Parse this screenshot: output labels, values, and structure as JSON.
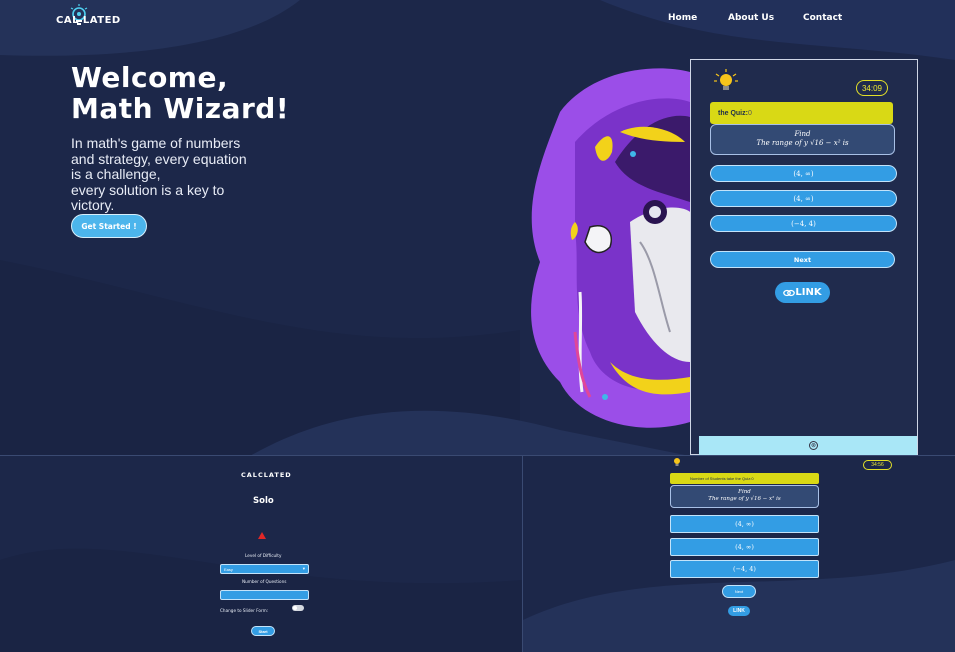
{
  "header": {
    "logo_text": "CAL  LATED",
    "nav": [
      "Home",
      "About Us",
      "Contact"
    ]
  },
  "hero": {
    "title_line1": "Welcome,",
    "title_line2": "Math Wizard!",
    "text_lines": [
      "In math's game of numbers",
      "and strategy, every equation",
      "is a challenge,",
      "every solution is a key to victory."
    ],
    "cta_label": "Get Started !"
  },
  "quiz_panel": {
    "timer": "34:09",
    "banner_label": "the Quiz:",
    "banner_score": "0",
    "question_line1": "Find",
    "question_line2": "The range of y √16 − x² is",
    "options": [
      "(4, ∞)",
      "(4, ∞)",
      "(−4, 4)"
    ],
    "next_label": "Next",
    "link_label": "LINK",
    "close_icon": "⊗"
  },
  "solo_panel": {
    "logo_text": "CALCLATED",
    "title": "Solo",
    "difficulty_label": "Level of Difficulty",
    "difficulty_value": "Easy",
    "questions_label": "Number of Questions",
    "slider_label": "Change to Slider Form:",
    "start_label": "Start"
  },
  "quiz_panel_small": {
    "timer": "34:56",
    "banner_text": "Number of Students take the Quiz:0",
    "question_line1": "Find",
    "question_line2": "The range of y √16 − x² is",
    "options": [
      "(4, ∞)",
      "(4, ∞)",
      "(−4, 4)"
    ],
    "next_label": "Next",
    "link_label": "LINK"
  },
  "colors": {
    "background": "#1c2749",
    "accent_blue": "#339de4",
    "accent_yellow": "#d9d915",
    "wizard_purple": "#9b4ee8"
  }
}
